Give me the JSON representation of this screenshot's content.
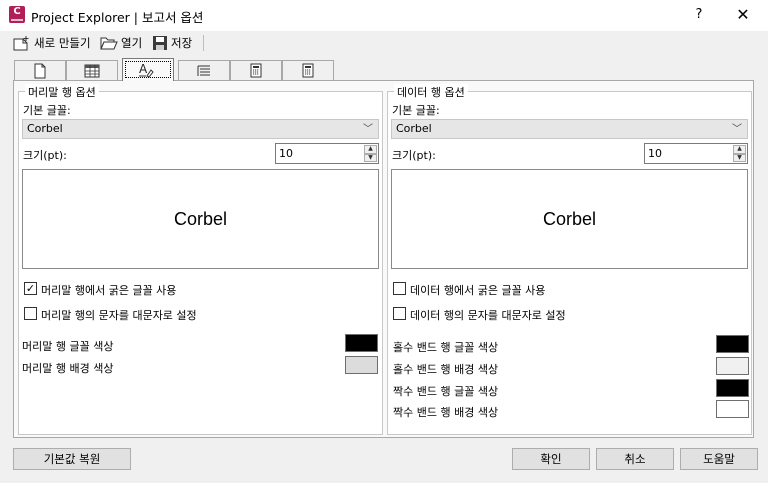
{
  "window": {
    "title": "Project Explorer | 보고서 옵션",
    "app_icon_letter": "C",
    "help_label": "?",
    "close_label": "✕"
  },
  "toolbar": {
    "new_label": "새로 만들기",
    "open_label": "열기",
    "save_label": "저장"
  },
  "tabs": [
    {
      "icon": "page-icon"
    },
    {
      "icon": "table-icon"
    },
    {
      "icon": "font-format-icon",
      "active": true
    },
    {
      "icon": "list-indent-icon"
    },
    {
      "icon": "calculator-icon"
    },
    {
      "icon": "report-icon"
    }
  ],
  "header_panel": {
    "title": "머리말 행 옵션",
    "font_label": "기본 글꼴:",
    "font_value": "Corbel",
    "size_label": "크기(pt):",
    "size_value": "10",
    "preview_text": "Corbel",
    "bold_label": "머리말 행에서 굵은 글꼴 사용",
    "bold_checked": true,
    "uppercase_label": "머리말 행의 문자를 대문자로 설정",
    "uppercase_checked": false,
    "colors": [
      {
        "label": "머리말 행 글꼴 색상",
        "color": "#000000"
      },
      {
        "label": "머리말 행 배경 색상",
        "color": "#dcdcdc"
      }
    ]
  },
  "data_panel": {
    "title": "데이터 행 옵션",
    "font_label": "기본 글꼴:",
    "font_value": "Corbel",
    "size_label": "크기(pt):",
    "size_value": "10",
    "preview_text": "Corbel",
    "bold_label": "데이터 행에서 굵은 글꼴 사용",
    "bold_checked": false,
    "uppercase_label": "데이터 행의 문자를 대문자로 설정",
    "uppercase_checked": false,
    "colors": [
      {
        "label": "홀수 밴드 행 글꼴 색상",
        "color": "#000000"
      },
      {
        "label": "홀수 밴드 행 배경 색상",
        "color": "#f0f0f0"
      },
      {
        "label": "짝수 밴드 행 글꼴 색상",
        "color": "#000000"
      },
      {
        "label": "짝수 밴드 행 배경 색상",
        "color": "#ffffff"
      }
    ]
  },
  "footer": {
    "restore_label": "기본값 복원",
    "ok_label": "확인",
    "cancel_label": "취소",
    "help_label": "도움말"
  }
}
